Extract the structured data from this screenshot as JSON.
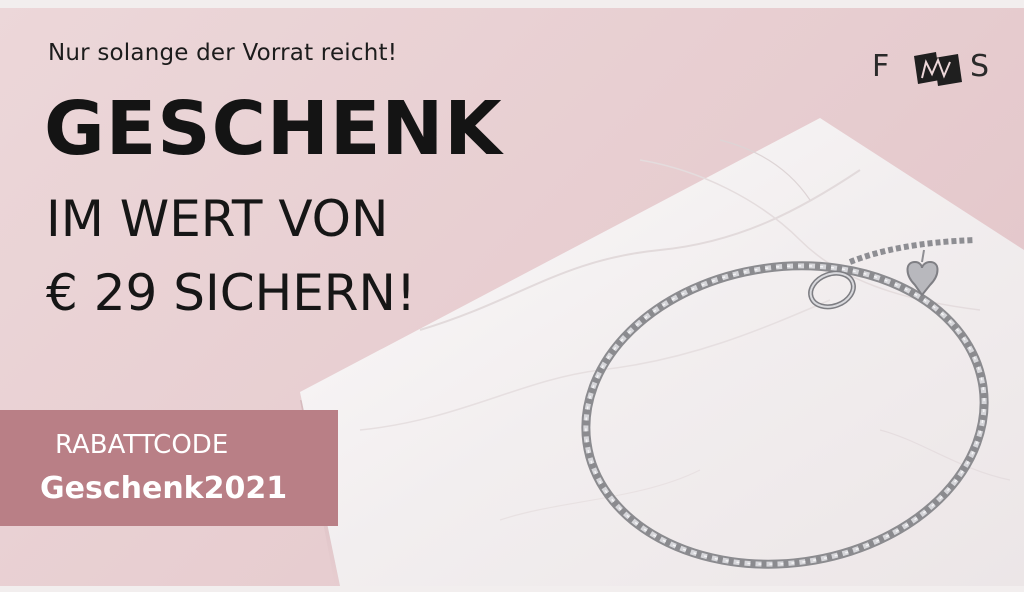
{
  "promo": {
    "tagline": "Nur solange der Vorrat reicht!",
    "headline": "GESCHENK",
    "subline_1": "IM WERT VON",
    "subline_2": "€ 29 SICHERN!"
  },
  "coupon": {
    "label": "RABATTCODE",
    "code": "Geschenk2021"
  },
  "brand": {
    "logo_left_letter": "F",
    "logo_right_letter": "S"
  },
  "product": {
    "icon": "bracelet-icon"
  },
  "colors": {
    "background": "#e7cdd0",
    "coupon_box": "#b97f86",
    "headline_text": "#141414",
    "coupon_text": "#ffffff"
  }
}
